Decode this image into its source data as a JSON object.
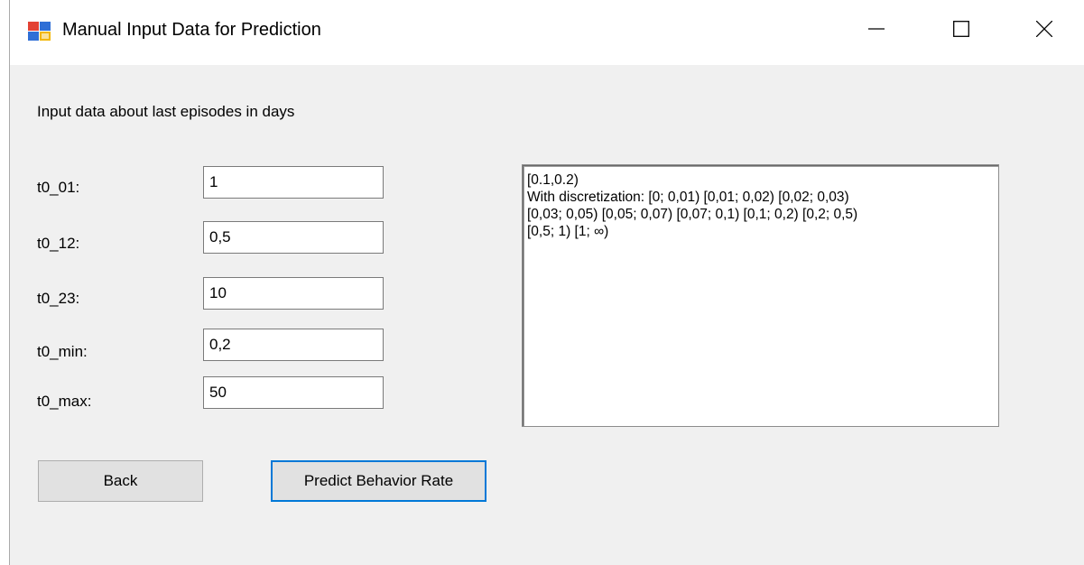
{
  "window": {
    "title": "Manual Input Data for Prediction",
    "icons": {
      "app": "app-form-icon",
      "minimize": "minimize-icon",
      "maximize": "maximize-icon",
      "close": "close-icon"
    }
  },
  "form": {
    "instruction": "Input data about last episodes in days",
    "fields": [
      {
        "label": "t0_01:",
        "value": "1"
      },
      {
        "label": "t0_12:",
        "value": "0,5"
      },
      {
        "label": "t0_23:",
        "value": "10"
      },
      {
        "label": "t0_min:",
        "value": "0,2"
      },
      {
        "label": "t0_max:",
        "value": "50"
      }
    ],
    "output_text": "[0.1,0.2)\nWith discretization: [0; 0,01) [0,01; 0,02) [0,02; 0,03)\n[0,03; 0,05) [0,05; 0,07) [0,07; 0,1) [0,1; 0,2) [0,2; 0,5)\n[0,5; 1) [1; ∞)"
  },
  "buttons": {
    "back_label": "Back",
    "predict_label": "Predict Behavior Rate"
  },
  "colors": {
    "window_background": "#f0f0f0",
    "titlebar_background": "#ffffff",
    "focus_accent": "#0078d7"
  }
}
